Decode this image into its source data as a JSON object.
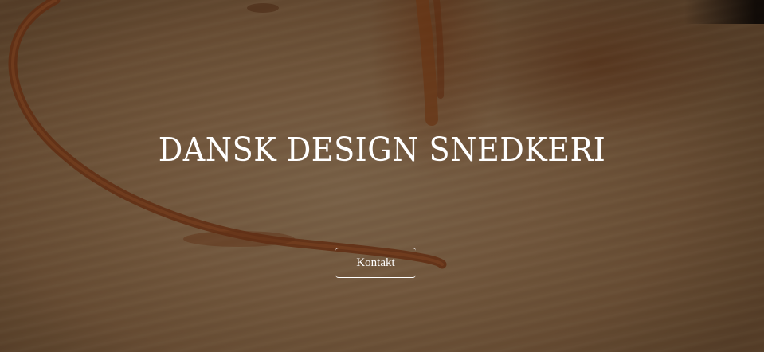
{
  "hero": {
    "title": "DANSK DESIGN SNEDKERI",
    "button_label": "Kontakt",
    "overlay_color": "#23160c",
    "title_color": "#ffffff"
  }
}
